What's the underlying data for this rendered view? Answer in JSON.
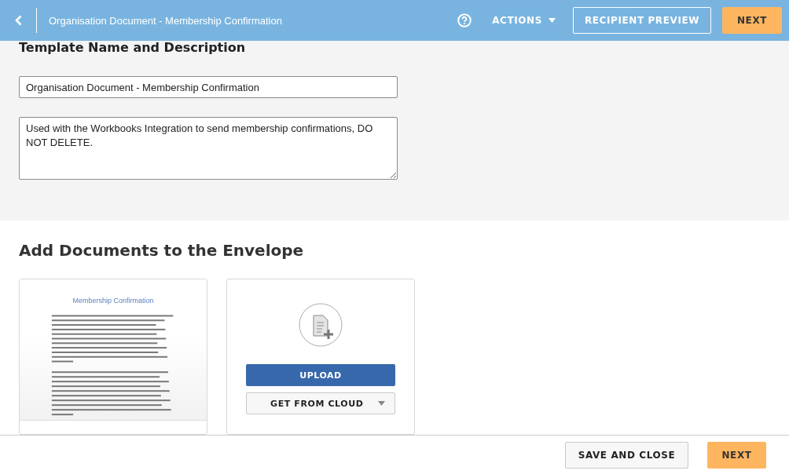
{
  "header": {
    "title": "Organisation Document - Membership Confirmation",
    "buttons": [
      {
        "label": "ACTIONS",
        "kind": "menu"
      },
      {
        "label": "RECIPIENT PREVIEW",
        "kind": "outline"
      },
      {
        "label": "NEXT",
        "kind": "primary"
      }
    ]
  },
  "template": {
    "heading": "Template Name and Description",
    "name_value": "Organisation Document - Membership Confirmation",
    "description_value": "Used with the Workbooks Integration to send membership confirmations, DO NOT DELETE."
  },
  "documents": {
    "heading": "Add Documents to the Envelope",
    "preview_title": "Membership Confirmation",
    "upload_button": "UPLOAD",
    "cloud_button": "GET FROM CLOUD"
  },
  "footer": {
    "buttons": [
      {
        "label": "SAVE AND CLOSE",
        "kind": "secondary"
      },
      {
        "label": "NEXT",
        "kind": "primary"
      }
    ]
  }
}
